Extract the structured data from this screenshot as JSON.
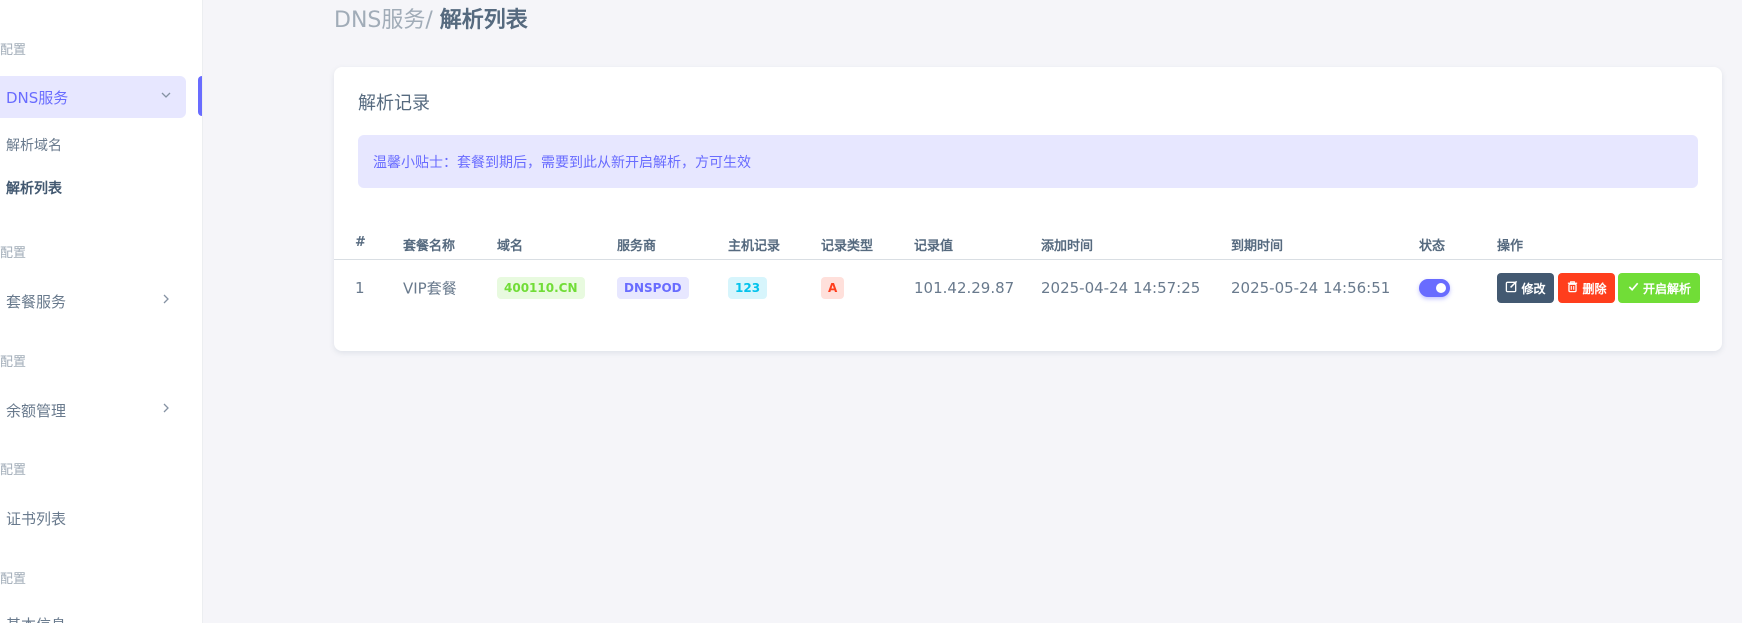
{
  "sidebar": {
    "headers": [
      "配置",
      "配置",
      "配置",
      "配置",
      "配置"
    ],
    "dns_menu": {
      "label": "DNS服务",
      "chevron": "chevron-down-icon"
    },
    "dns_sub": [
      "解析域名",
      "解析列表"
    ],
    "package_menu": {
      "label": "套餐服务",
      "chevron": "chevron-right-icon"
    },
    "balance_menu": {
      "label": "余额管理",
      "chevron": "chevron-right-icon"
    },
    "cert_menu": {
      "label": "证书列表"
    },
    "clipped_item": "基本信息"
  },
  "breadcrumb": {
    "parent": "DNS服务/ ",
    "current": "解析列表"
  },
  "card": {
    "title": "解析记录",
    "alert": "温馨小贴士：套餐到期后，需要到此从新开启解析，方可生效"
  },
  "table": {
    "headers": [
      "#",
      "套餐名称",
      "域名",
      "服务商",
      "主机记录",
      "记录类型",
      "记录值",
      "添加时间",
      "到期时间",
      "状态",
      "操作"
    ],
    "rows": [
      {
        "index": "1",
        "package": "VIP套餐",
        "domain": "400110.CN",
        "provider": "DNSPOD",
        "host": "123",
        "type": "A",
        "value": "101.42.29.87",
        "added": "2025-04-24 14:57:25",
        "expires": "2025-05-24 14:56:51",
        "status_on": true,
        "actions": {
          "edit": "修改",
          "delete": "删除",
          "enable": "开启解析"
        }
      }
    ]
  },
  "colors": {
    "primary": "#696cff",
    "success": "#71dd37",
    "danger": "#ff3e1d",
    "info": "#03c3ec",
    "dark": "#435971"
  }
}
